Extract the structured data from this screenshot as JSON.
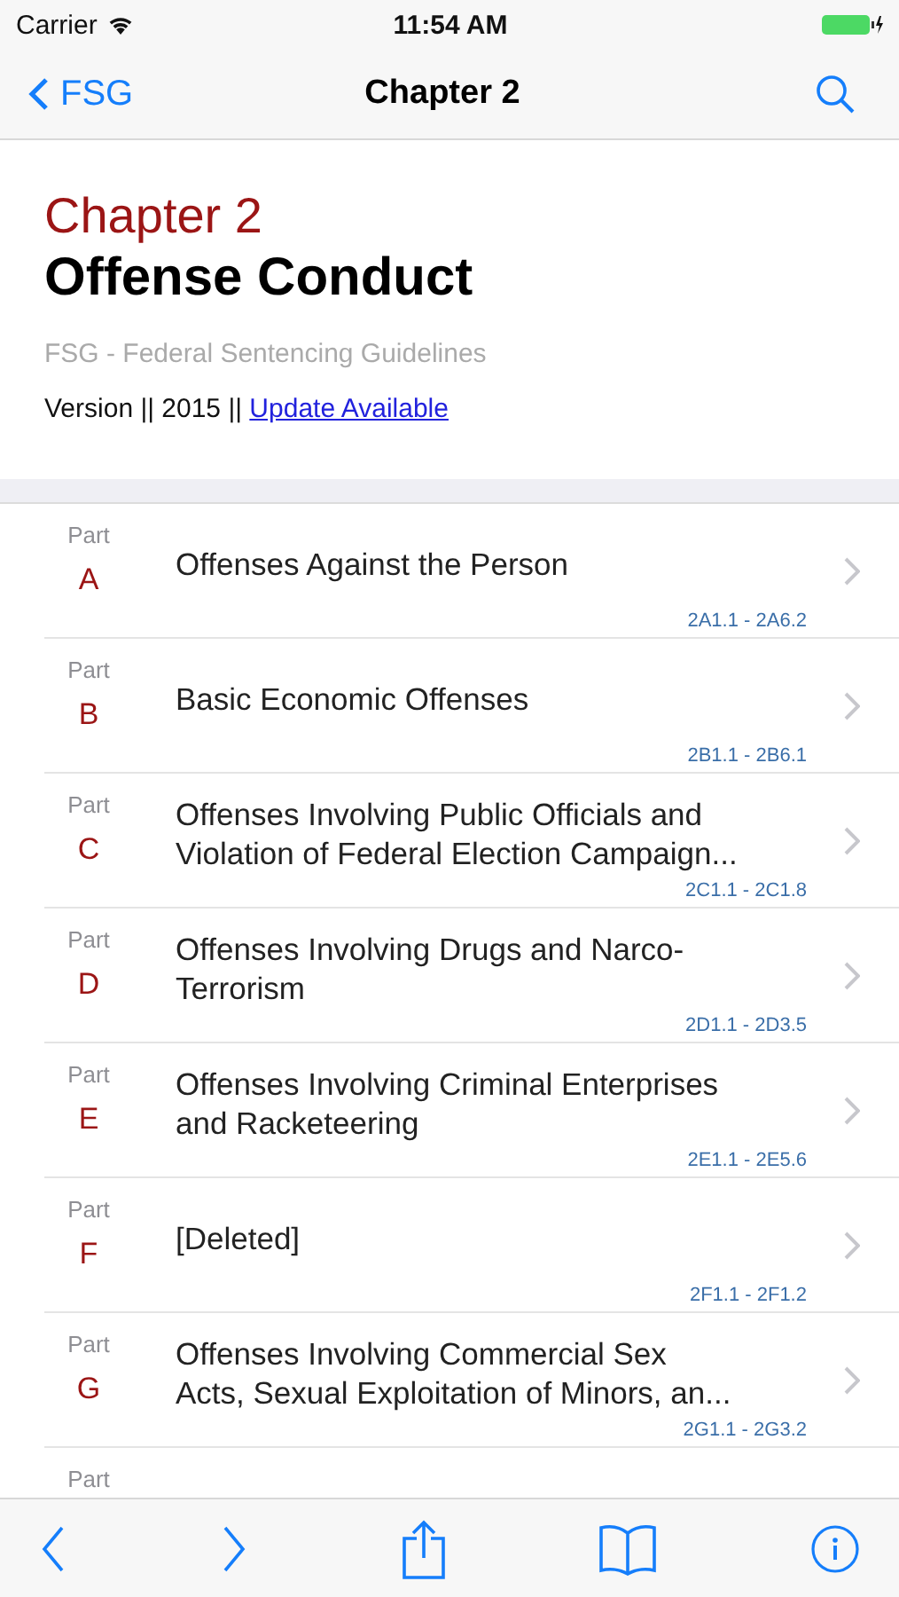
{
  "status_bar": {
    "carrier": "Carrier",
    "time": "11:54 AM"
  },
  "nav_bar": {
    "back": "FSG",
    "title": "Chapter 2"
  },
  "header": {
    "chapter": "Chapter 2",
    "title": "Offense Conduct",
    "subtitle": "FSG - Federal Sentencing Guidelines",
    "version": "Version || 2015 || ",
    "update_link": "Update Available"
  },
  "parts": [
    {
      "label": "Part",
      "letter": "A",
      "title": "Offenses Against the Person",
      "range": "2A1.1 - 2A6.2"
    },
    {
      "label": "Part",
      "letter": "B",
      "title": "Basic Economic Offenses",
      "range": "2B1.1 - 2B6.1"
    },
    {
      "label": "Part",
      "letter": "C",
      "title": "Offenses Involving Public Officials and\nViolation of Federal Election Campaign...",
      "range": "2C1.1 - 2C1.8"
    },
    {
      "label": "Part",
      "letter": "D",
      "title": "Offenses Involving Drugs and Narco-\nTerrorism",
      "range": "2D1.1 - 2D3.5"
    },
    {
      "label": "Part",
      "letter": "E",
      "title": "Offenses Involving Criminal Enterprises\nand Racketeering",
      "range": "2E1.1 - 2E5.6"
    },
    {
      "label": "Part",
      "letter": "F",
      "title": "[Deleted]",
      "range": "2F1.1 - 2F1.2"
    },
    {
      "label": "Part",
      "letter": "G",
      "title": "Offenses Involving Commercial Sex\nActs, Sexual Exploitation of Minors, an...",
      "range": "2G1.1 - 2G3.2"
    },
    {
      "label": "Part"
    }
  ]
}
